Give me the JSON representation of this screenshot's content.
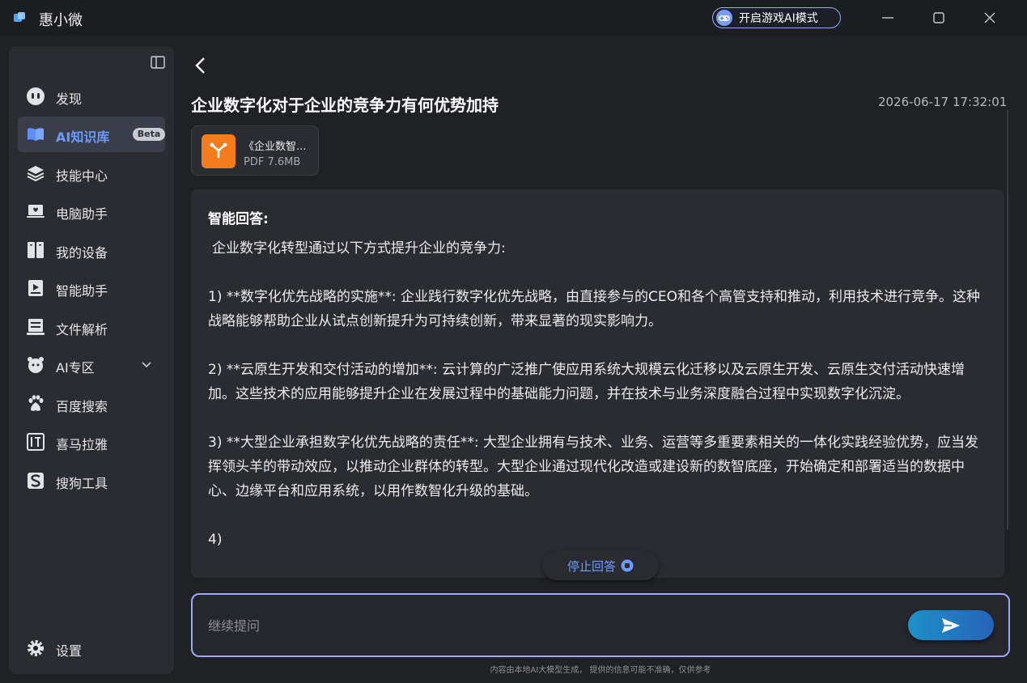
{
  "app": {
    "title": "惠小微"
  },
  "titlebar": {
    "game_mode_label": "开启游戏AI模式"
  },
  "sidebar": {
    "items": [
      {
        "label": "发现",
        "icon": "discover-icon"
      },
      {
        "label": "AI知识库",
        "icon": "knowledge-book-icon",
        "badge": "Beta",
        "active": true
      },
      {
        "label": "技能中心",
        "icon": "layers-icon"
      },
      {
        "label": "电脑助手",
        "icon": "laptop-icon"
      },
      {
        "label": "我的设备",
        "icon": "devices-icon"
      },
      {
        "label": "智能助手",
        "icon": "assistant-icon"
      },
      {
        "label": "文件解析",
        "icon": "file-parse-icon"
      },
      {
        "label": "AI专区",
        "icon": "ai-zone-icon",
        "expandable": true
      },
      {
        "label": "百度搜索",
        "icon": "baidu-paw-icon"
      },
      {
        "label": "喜马拉雅",
        "icon": "ximalaya-icon"
      },
      {
        "label": "搜狗工具",
        "icon": "sogou-icon"
      }
    ],
    "settings_label": "设置"
  },
  "question": {
    "title": "企业数字化对于企业的竞争力有何优势加持",
    "timestamp": "2026-06-17 17:32:01"
  },
  "file": {
    "name": "《企业数智...",
    "meta": "PDF 7.6MB"
  },
  "answer": {
    "heading": "智能回答:",
    "intro": "企业数字化转型通过以下方式提升企业的竞争力:",
    "paragraphs": [
      "1) **数字化优先战略的实施**: 企业践行数字化优先战略，由直接参与的CEO和各个高管支持和推动，利用技术进行竞争。这种战略能够帮助企业从试点创新提升为可持续创新，带来显著的现实影响力。",
      "2) **云原生开发和交付活动的增加**: 云计算的广泛推广使应用系统大规模云化迁移以及云原生开发、云原生交付活动快速增加。这些技术的应用能够提升企业在发展过程中的基础能力问题，并在技术与业务深度融合过程中实现数字化沉淀。",
      "3) **大型企业承担数字化优先战略的责任**: 大型企业拥有与技术、业务、运营等多重要素相关的一体化实践经验优势，应当发挥领头羊的带动效应，以推动企业群体的转型。大型企业通过现代化改造或建设新的数智底座，开始确定和部署适当的数据中心、边缘平台和应用系统，以用作数智化升级的基础。",
      "4)"
    ],
    "stop_label": "停止回答"
  },
  "input": {
    "placeholder": "继续提问"
  },
  "footer": {
    "disclaimer": "内容由本地AI大模型生成， 提供的信息可能不准确，仅供参考"
  },
  "colors": {
    "accent": "#6b9bff",
    "file_icon": "#f47c1c",
    "send_start": "#1e90c9",
    "send_end": "#2563b8"
  }
}
